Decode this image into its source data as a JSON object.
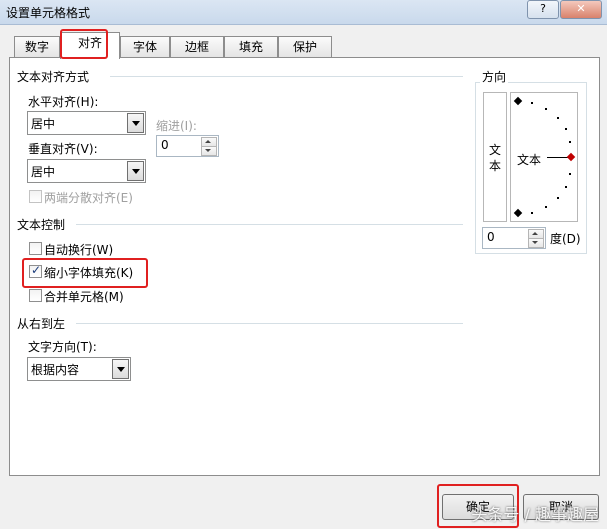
{
  "window": {
    "title": "设置单元格格式",
    "help": "?",
    "close": "✕"
  },
  "tabs": [
    {
      "label": "数字"
    },
    {
      "label": "对齐"
    },
    {
      "label": "字体"
    },
    {
      "label": "边框"
    },
    {
      "label": "填充"
    },
    {
      "label": "保护"
    }
  ],
  "alignment": {
    "section_title": "文本对齐方式",
    "horizontal_label": "水平对齐(H):",
    "horizontal_value": "居中",
    "indent_label": "缩进(I):",
    "indent_value": "0",
    "vertical_label": "垂直对齐(V):",
    "vertical_value": "居中",
    "distributed_label": "两端分散对齐(E)"
  },
  "text_control": {
    "section_title": "文本控制",
    "wrap_label": "自动换行(W)",
    "wrap_checked": false,
    "shrink_label": "缩小字体填充(K)",
    "shrink_checked": true,
    "merge_label": "合并单元格(M)",
    "merge_checked": false
  },
  "rtl": {
    "section_title": "从右到左",
    "direction_label": "文字方向(T):",
    "direction_value": "根据内容"
  },
  "orientation": {
    "section_title": "方向",
    "vertical_text": [
      "文",
      "本"
    ],
    "dial_text": "文本",
    "degree_value": "0",
    "degree_label": "度(D)"
  },
  "buttons": {
    "ok": "确定",
    "cancel": "取消"
  },
  "watermark": "头条号 / 趣事趣屋"
}
